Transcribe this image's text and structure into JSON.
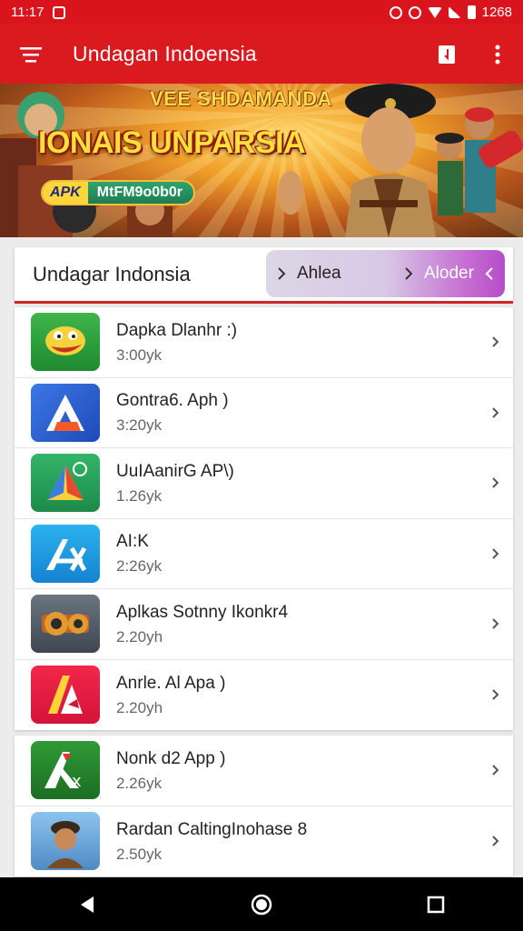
{
  "status_bar": {
    "time": "11:17",
    "battery": "1268"
  },
  "app_bar": {
    "title": "Undagan Indoensia"
  },
  "banner": {
    "top_text": "VEE SHDAMANDA",
    "headline": "IONAIS UNPARSIA",
    "pill_tag": "APK",
    "pill_text": "MtFM9o0b0r"
  },
  "header_card": {
    "title": "Undagar Indonsia",
    "seg_left": "Ahlea",
    "seg_right": "Aloder"
  },
  "apps": [
    {
      "name": "Dapka Dlanhr :)",
      "size": "3:00yk",
      "icon": "happy-bird-icon",
      "color": "#2a9d3e"
    },
    {
      "name": "Gontra6. Aph )",
      "size": "3:20yk",
      "icon": "letter-a-icon",
      "color": "#2b62d9"
    },
    {
      "name": "UuIAanirG AP\\)",
      "size": "1.26yk",
      "icon": "paper-plane-icon",
      "color": "#25a55b"
    },
    {
      "name": "AI:K",
      "size": "2:26yk",
      "icon": "app-store-a-icon",
      "color": "#1e9ae0"
    },
    {
      "name": "Aplkas Sotnny Ikonkr4",
      "size": "2.20yh",
      "icon": "film-reel-icon",
      "color": "#4f5a66"
    },
    {
      "name": "Anrle. Al Apa )",
      "size": "2.20yh",
      "icon": "stylized-a-icon",
      "color": "#e8213a"
    }
  ],
  "apps2": [
    {
      "name": "Nonk d2 App )",
      "size": "2.26yk",
      "icon": "green-a-icon",
      "color": "#2b8a2f"
    },
    {
      "name": "Rardan CaltingInohase 8",
      "size": "2.50yk",
      "icon": "portrait-icon",
      "color": "#6aa5d8"
    }
  ]
}
